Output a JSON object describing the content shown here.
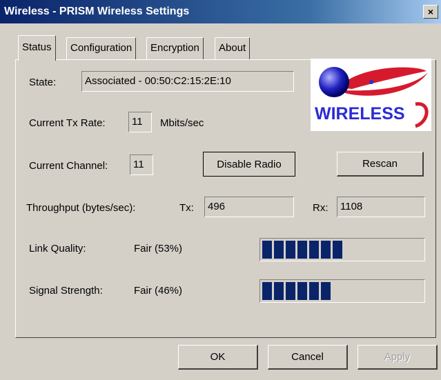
{
  "window": {
    "title": "Wireless - PRISM Wireless Settings",
    "close_glyph": "×"
  },
  "tabs": [
    "Status",
    "Configuration",
    "Encryption",
    "About"
  ],
  "status": {
    "state_label": "State:",
    "state_value": "Associated - 00:50:C2:15:2E:10",
    "tx_rate_label": "Current Tx Rate:",
    "tx_rate_value": "11",
    "tx_rate_unit": "Mbits/sec",
    "channel_label": "Current Channel:",
    "channel_value": "11",
    "disable_radio": "Disable Radio",
    "rescan": "Rescan",
    "throughput_label": "Throughput (bytes/sec):",
    "tx_label": "Tx:",
    "tx_value": "496",
    "rx_label": "Rx:",
    "rx_value": "1108",
    "link_quality_label": "Link Quality:",
    "link_quality_text": "Fair (53%)",
    "link_quality_percent": 53,
    "signal_strength_label": "Signal Strength:",
    "signal_strength_text": "Fair (46%)",
    "signal_strength_percent": 46
  },
  "logo": {
    "text": "WIRELESS",
    "icon": "wireless-globe-swoosh-logo",
    "color": "#2b2bd6",
    "accent": "#d61a2e"
  },
  "footer": {
    "ok": "OK",
    "cancel": "Cancel",
    "apply": "Apply"
  },
  "colors": {
    "title_bar": "#0a246a",
    "bar_fill": "#0a246a",
    "face": "#d4d0c8"
  }
}
